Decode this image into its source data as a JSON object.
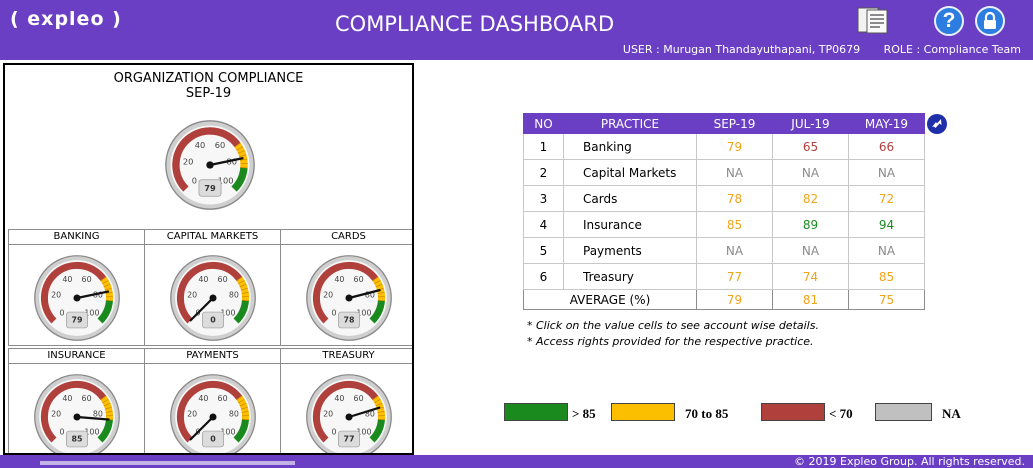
{
  "header": {
    "logo": "( expleo )",
    "title": "COMPLIANCE DASHBOARD",
    "user": "USER : Murugan Thandayuthapani, TP0679",
    "role": "ROLE : Compliance Team",
    "help_glyph": "?"
  },
  "org": {
    "title": "ORGANIZATION COMPLIANCE",
    "month": "SEP-19",
    "value": 79
  },
  "gauge_ticks": [
    "0",
    "20",
    "40",
    "60",
    "80",
    "100"
  ],
  "gauges": [
    {
      "label": "BANKING",
      "value": 79
    },
    {
      "label": "CAPITAL MARKETS",
      "value": 0
    },
    {
      "label": "CARDS",
      "value": 78
    },
    {
      "label": "INSURANCE",
      "value": 85
    },
    {
      "label": "PAYMENTS",
      "value": 0
    },
    {
      "label": "TREASURY",
      "value": 77
    }
  ],
  "table": {
    "headers": [
      "NO",
      "PRACTICE",
      "SEP-19",
      "JUL-19",
      "MAY-19"
    ],
    "rows": [
      {
        "no": "1",
        "practice": "Banking",
        "sep": "79",
        "jul": "65",
        "may": "66"
      },
      {
        "no": "2",
        "practice": "Capital Markets",
        "sep": "NA",
        "jul": "NA",
        "may": "NA"
      },
      {
        "no": "3",
        "practice": "Cards",
        "sep": "78",
        "jul": "82",
        "may": "72"
      },
      {
        "no": "4",
        "practice": "Insurance",
        "sep": "85",
        "jul": "89",
        "may": "94"
      },
      {
        "no": "5",
        "practice": "Payments",
        "sep": "NA",
        "jul": "NA",
        "may": "NA"
      },
      {
        "no": "6",
        "practice": "Treasury",
        "sep": "77",
        "jul": "74",
        "may": "85"
      }
    ],
    "average_label": "AVERAGE (%)",
    "average": {
      "sep": "79",
      "jul": "81",
      "may": "75"
    }
  },
  "notes": [
    "* Click on the value cells to see account wise details.",
    "* Access rights provided for the respective practice."
  ],
  "legend": [
    {
      "label": "> 85",
      "color": "#1a8a1f"
    },
    {
      "label": "70 to 85",
      "color": "#fbbf00"
    },
    {
      "label": "< 70",
      "color": "#b0403c"
    },
    {
      "label": "NA",
      "color": "#c0c0c0"
    }
  ],
  "colors": {
    "header_bg": "#6a3fc4",
    "value_green": "#1a8a1f",
    "value_amber": "#f0a418",
    "value_red": "#b0403c",
    "value_na": "#8a8a8a"
  },
  "footer": "© 2019 Expleo Group. All rights reserved."
}
